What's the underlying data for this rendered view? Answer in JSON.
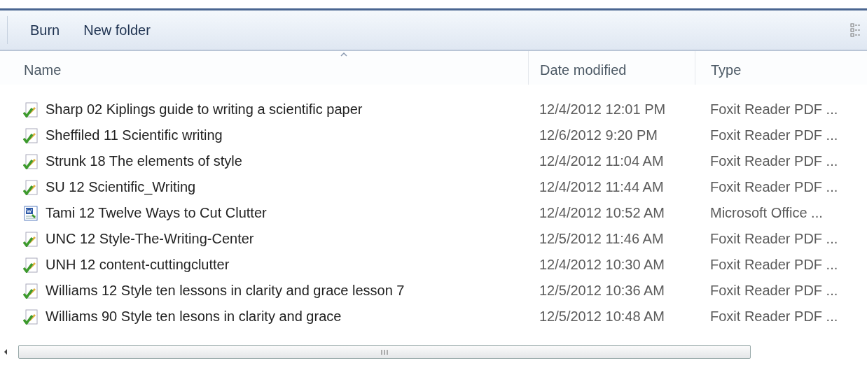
{
  "toolbar": {
    "buttons": [
      {
        "label": "Burn"
      },
      {
        "label": "New folder"
      }
    ]
  },
  "table": {
    "columns": [
      {
        "label": "Name",
        "sorted": true
      },
      {
        "label": "Date modified",
        "sorted": false
      },
      {
        "label": "Type",
        "sorted": false
      }
    ],
    "rows": [
      {
        "kind": "pdf",
        "name": "Sharp 02 Kiplings guide to writing a scientific paper",
        "date": "12/4/2012 12:01 PM",
        "type": "Foxit Reader PDF ..."
      },
      {
        "kind": "pdf",
        "name": "Sheffiled 11 Scientific writing",
        "date": "12/6/2012 9:20 PM",
        "type": "Foxit Reader PDF ..."
      },
      {
        "kind": "pdf",
        "name": "Strunk 18 The elements of style",
        "date": "12/4/2012 11:04 AM",
        "type": "Foxit Reader PDF ..."
      },
      {
        "kind": "pdf",
        "name": "SU 12 Scientific_Writing",
        "date": "12/4/2012 11:44 AM",
        "type": "Foxit Reader PDF ..."
      },
      {
        "kind": "doc",
        "name": "Tami 12 Twelve Ways to Cut Clutter",
        "date": "12/4/2012 10:52 AM",
        "type": "Microsoft Office ..."
      },
      {
        "kind": "pdf",
        "name": "UNC 12 Style-The-Writing-Center",
        "date": "12/5/2012 11:46 AM",
        "type": "Foxit Reader PDF ..."
      },
      {
        "kind": "pdf",
        "name": "UNH 12 content-cuttingclutter",
        "date": "12/4/2012 10:30 AM",
        "type": "Foxit Reader PDF ..."
      },
      {
        "kind": "pdf",
        "name": "Williams 12 Style ten lessons in clarity and grace lesson 7",
        "date": "12/5/2012 10:36 AM",
        "type": "Foxit Reader PDF ..."
      },
      {
        "kind": "pdf",
        "name": "Williams 90 Style ten lesons in clarity and grace",
        "date": "12/5/2012 10:48 AM",
        "type": "Foxit Reader PDF ..."
      }
    ]
  }
}
